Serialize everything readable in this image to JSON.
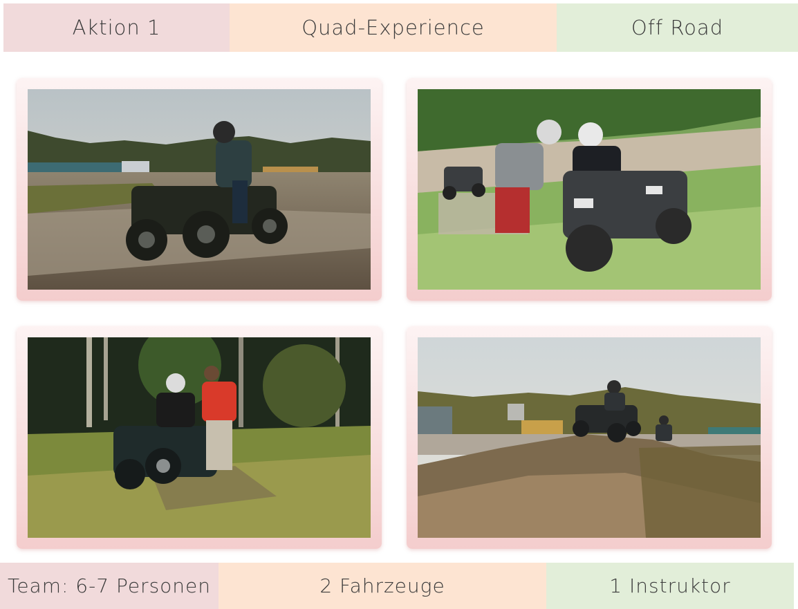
{
  "header": {
    "action_label": "Aktion 1",
    "title": "Quad-Experience",
    "category": "Off Road"
  },
  "photos": [
    {
      "icon": "quad-rider-dirt-track-photo"
    },
    {
      "icon": "instructor-helping-quad-rider-photo"
    },
    {
      "icon": "quad-in-forest-meadow-photo"
    },
    {
      "icon": "quad-on-dirt-mound-photo"
    }
  ],
  "footer": {
    "team": "Team: 6-7 Personen",
    "vehicles": "2 Fahrzeuge",
    "instructor": "1 Instruktor"
  },
  "colors": {
    "pink": "#f1dadb",
    "peach": "#fde4d2",
    "green": "#e2eed9",
    "frame": "#f4cdcd"
  }
}
